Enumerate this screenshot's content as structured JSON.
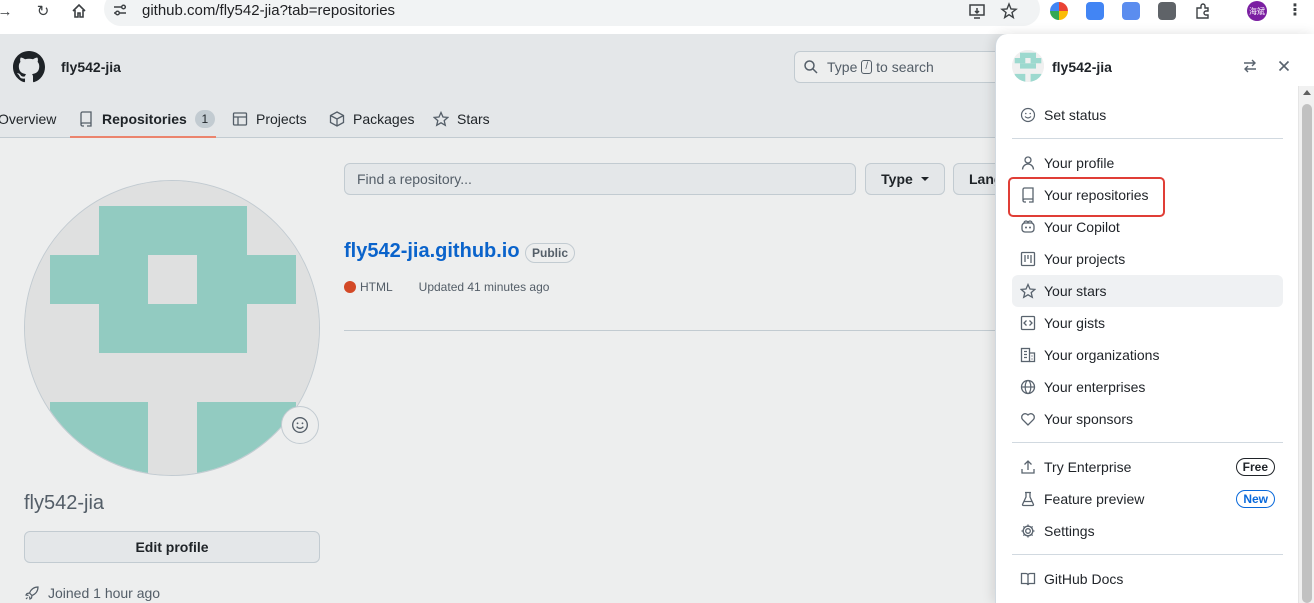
{
  "browser": {
    "url": "github.com/fly542-jia?tab=repositories",
    "profile_badge": "海斌"
  },
  "header": {
    "username": "fly542-jia",
    "search_prefix": "Type",
    "search_key": "/",
    "search_suffix": "to search"
  },
  "tabs": [
    {
      "label": "Overview",
      "icon": "book-icon"
    },
    {
      "label": "Repositories",
      "icon": "repo-icon",
      "counter": "1",
      "selected": true
    },
    {
      "label": "Projects",
      "icon": "table-icon"
    },
    {
      "label": "Packages",
      "icon": "package-icon"
    },
    {
      "label": "Stars",
      "icon": "star-icon"
    }
  ],
  "profile": {
    "name": "fly542-jia",
    "edit_label": "Edit profile",
    "joined": "Joined 1 hour ago"
  },
  "repo_filters": {
    "find_placeholder": "Find a repository...",
    "type_label": "Type",
    "language_label": "Language"
  },
  "repos": [
    {
      "name": "fly542-jia.github.io",
      "visibility": "Public",
      "language": "HTML",
      "language_color": "#e34c26",
      "updated": "Updated 41 minutes ago"
    }
  ],
  "menu": {
    "username": "fly542-jia",
    "items": [
      {
        "label": "Set status",
        "icon": "smiley-icon"
      },
      {
        "label": "Your profile",
        "icon": "person-icon"
      },
      {
        "label": "Your repositories",
        "icon": "repo-icon"
      },
      {
        "label": "Your Copilot",
        "icon": "copilot-icon"
      },
      {
        "label": "Your projects",
        "icon": "project-icon"
      },
      {
        "label": "Your stars",
        "icon": "star-icon"
      },
      {
        "label": "Your gists",
        "icon": "code-square-icon"
      },
      {
        "label": "Your organizations",
        "icon": "organization-icon"
      },
      {
        "label": "Your enterprises",
        "icon": "globe-icon"
      },
      {
        "label": "Your sponsors",
        "icon": "heart-icon"
      },
      {
        "label": "Try Enterprise",
        "icon": "upload-icon",
        "badge": "Free"
      },
      {
        "label": "Feature preview",
        "icon": "beaker-icon",
        "badge": "New"
      },
      {
        "label": "Settings",
        "icon": "gear-icon"
      },
      {
        "label": "GitHub Docs",
        "icon": "book-icon"
      }
    ]
  },
  "colors": {
    "accent_blue": "#0969da",
    "tab_underline": "#fd8c73",
    "identicon": "#9dd9cf",
    "highlight": "#e03e36"
  }
}
